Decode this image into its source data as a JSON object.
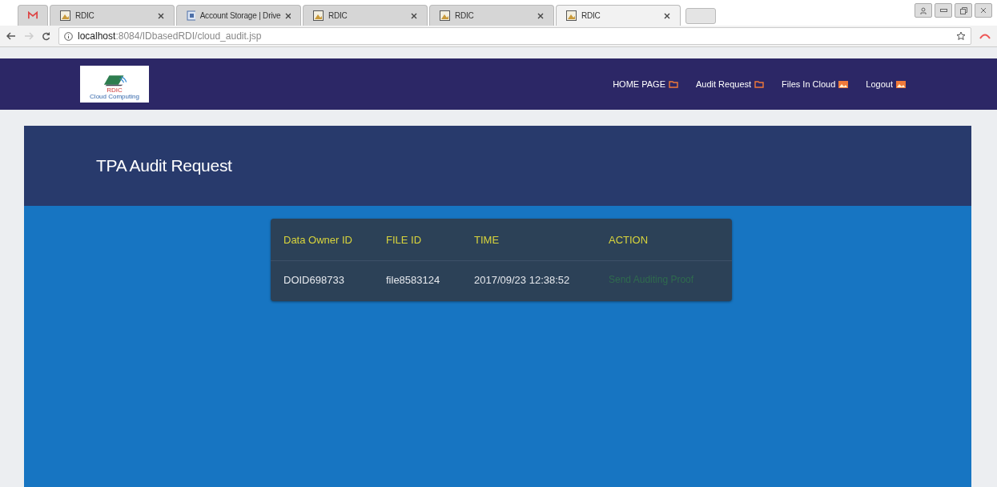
{
  "browser": {
    "tabs": [
      {
        "kind": "mail",
        "selected": false
      },
      {
        "kind": "page",
        "label": "RDIC",
        "selected": false
      },
      {
        "kind": "doc",
        "label": "Account Storage | Drive",
        "selected": false
      },
      {
        "kind": "page",
        "label": "RDIC",
        "selected": false
      },
      {
        "kind": "page",
        "label": "RDIC",
        "selected": false
      },
      {
        "kind": "page",
        "label": "RDIC",
        "selected": true
      }
    ],
    "address": {
      "host": "localhost",
      "path": ":8084/IDbasedRDI/cloud_audit.jsp"
    }
  },
  "site": {
    "logo": {
      "title": "RDIC",
      "subtitle": "Cloud Computing"
    },
    "nav": [
      {
        "label": "HOME PAGE",
        "kind": "folder"
      },
      {
        "label": "Audit Request",
        "kind": "folder"
      },
      {
        "label": "Files In Cloud",
        "kind": "picture"
      },
      {
        "label": "Logout",
        "kind": "picture"
      }
    ],
    "heading": "TPA Audit Request",
    "table": {
      "columns": [
        "Data Owner ID",
        "FILE ID",
        "TIME",
        "ACTION"
      ],
      "rows": [
        {
          "owner": "DOID698733",
          "file": "file8583124",
          "time": "2017/09/23 12:38:52",
          "action": "Send Auditing Proof"
        }
      ]
    }
  }
}
